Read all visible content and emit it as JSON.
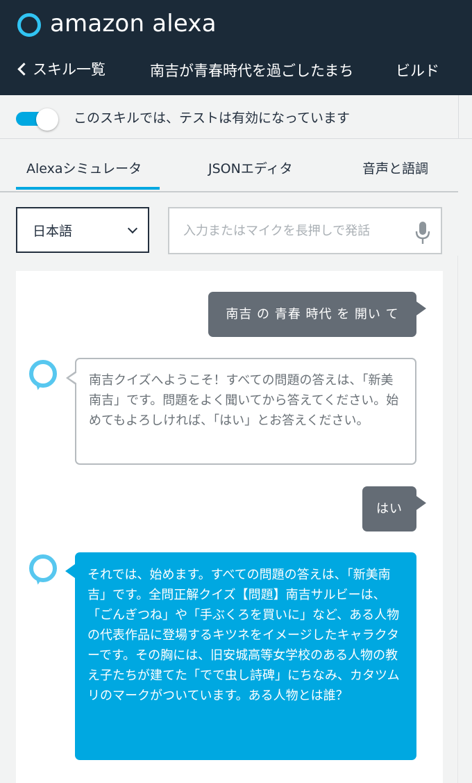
{
  "header": {
    "brand": "amazon alexa",
    "back_label": "スキル一覧",
    "skill_name": "南吉が青春時代を過ごしたまち",
    "build_tab": "ビルド"
  },
  "test_toggle": {
    "enabled": true,
    "text": "このスキルでは、テストは有効になっています"
  },
  "tabs": [
    {
      "label": "Alexaシミュレータ",
      "active": true
    },
    {
      "label": "JSONエディタ",
      "active": false
    },
    {
      "label": "音声と語調",
      "active": false
    }
  ],
  "language_select": {
    "value": "日本語"
  },
  "utterance_input": {
    "placeholder": "入力またはマイクを長押しで発話",
    "value": ""
  },
  "conversation": [
    {
      "speaker": "user",
      "text": "南吉 の 青春 時代 を 開い て"
    },
    {
      "speaker": "alexa",
      "text": "南吉クイズへようこそ！すべての問題の答えは、「新美南吉」です。問題をよく聞いてから答えてください。始めてもよろしければ、「はい」とお答えください。"
    },
    {
      "speaker": "user",
      "text": "はい"
    },
    {
      "speaker": "alexa",
      "text": "それでは、始めます。すべての問題の答えは、「新美南吉」です。全問正解クイズ【問題】南吉サルビーは、「ごんぎつね」や「手ぶくろを買いに」など、ある人物の代表作品に登場するキツネをイメージしたキャラクターです。その胸には、旧安城高等女学校のある人物の教え子たちが建てた「でで虫し詩碑」にちなみ、カタツムリのマークがついています。ある人物とは誰？"
    }
  ],
  "colors": {
    "header_bg": "#1b2a38",
    "accent": "#00a8e1",
    "user_bubble": "#646c75",
    "alexa_ring": "#57c7ef"
  }
}
